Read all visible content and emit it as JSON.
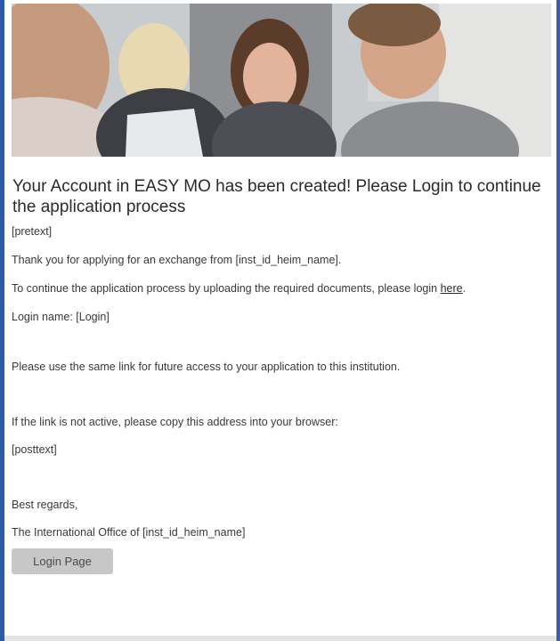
{
  "email": {
    "title": "Your Account in EASY MO has been created! Please Login to continue the application process",
    "pretext": "[pretext]",
    "thank_you": "Thank you for applying for an exchange from [inst_id_heim_name].",
    "continue_text": "To continue the application process by uploading the required documents, please login",
    "continue_link": "here",
    "continue_end": ".",
    "login_name": "Login name: [Login]",
    "same_link": "Please use the same link for future access to your application to this institution.",
    "link_inactive": "If the link is not active, please copy this address into your  browser:",
    "posttext": "[posttext]",
    "regards": "Best regards,",
    "signature": "The International Office of [inst_id_heim_name]",
    "button_label": "Login Page"
  }
}
